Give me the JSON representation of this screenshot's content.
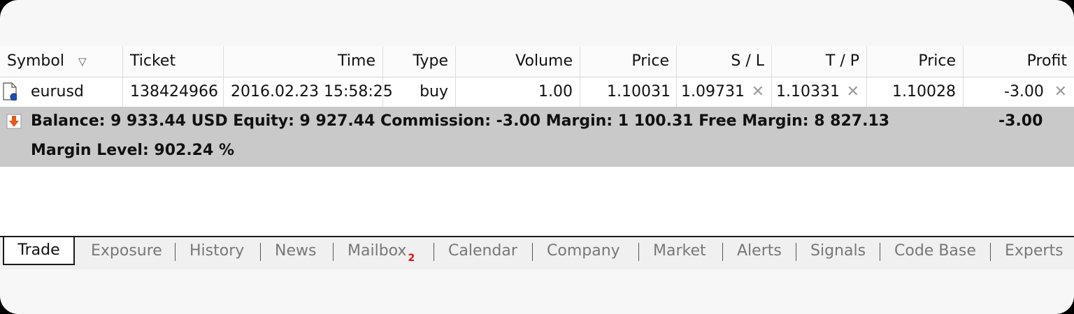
{
  "columns": {
    "symbol": "Symbol",
    "ticket": "Ticket",
    "time": "Time",
    "type": "Type",
    "volume": "Volume",
    "price": "Price",
    "sl": "S / L",
    "tp": "T / P",
    "price2": "Price",
    "profit": "Profit"
  },
  "order": {
    "symbol": "eurusd",
    "ticket": "138424966",
    "time": "2016.02.23 15:58:25",
    "type": "buy",
    "volume": "1.00",
    "price": "1.10031",
    "sl": "1.09731",
    "tp": "1.10331",
    "current_price": "1.10028",
    "profit": "-3.00",
    "remove_glyph": "✕"
  },
  "summary": {
    "line1": "Balance: 9 933.44 USD  Equity: 9 927.44  Commission: -3.00  Margin: 1 100.31  Free Margin: 8 827.13",
    "line2": "Margin Level: 902.24 %",
    "total_profit": "-3.00"
  },
  "tabs": {
    "active": "Trade",
    "items": [
      "Exposure",
      "History",
      "News",
      "Mailbox",
      "Calendar",
      "Company",
      "Market",
      "Alerts",
      "Signals",
      "Code Base",
      "Experts"
    ],
    "mailbox_badge": "2"
  },
  "colors": {
    "summary_bg": "#c9c9c9",
    "badge": "#e01010",
    "down_icon": "#e35a1b"
  }
}
